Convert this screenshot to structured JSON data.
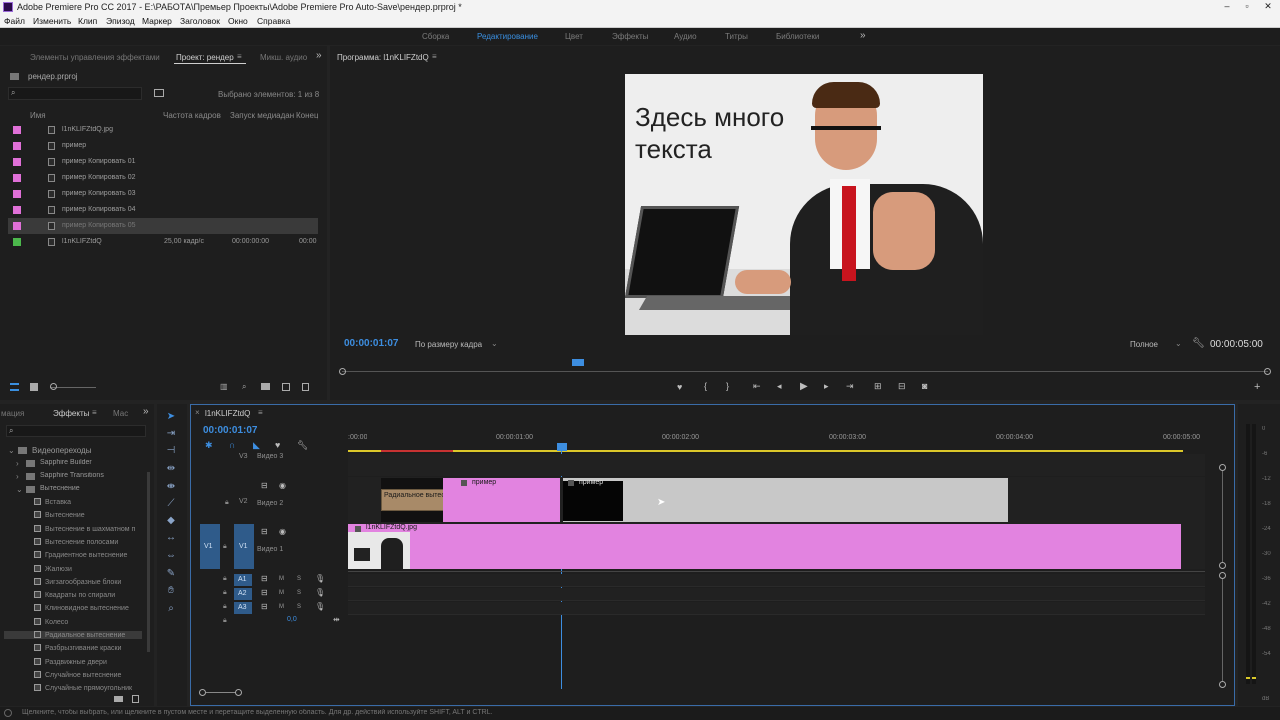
{
  "window": {
    "title": "Adobe Premiere Pro CC 2017 - E:\\РАБОТА\\Премьер Проекты\\Adobe Premiere Pro Auto-Save\\рендер.prproj *"
  },
  "menu": [
    "Файл",
    "Изменить",
    "Клип",
    "Эпизод",
    "Маркер",
    "Заголовок",
    "Окно",
    "Справка"
  ],
  "workspaces": [
    "Сборка",
    "Редактирование",
    "Цвет",
    "Эффекты",
    "Аудио",
    "Титры",
    "Библиотеки"
  ],
  "project": {
    "tabs": [
      "Элементы управления эффектами",
      "Проект: рендер",
      "Микш. аудио"
    ],
    "filename": "рендер.prproj",
    "selected": "Выбрано элементов: 1 из 8",
    "columns": [
      "Имя",
      "Частота кадров",
      "Запуск медиаданн",
      "Конец"
    ],
    "items": [
      {
        "name": "l1nKLIFZtdQ.jpg",
        "fps": "",
        "start": "",
        "color": "#e070d8"
      },
      {
        "name": "пример",
        "fps": "",
        "start": "",
        "color": "#e070d8"
      },
      {
        "name": "пример Копировать 01",
        "fps": "",
        "start": "",
        "color": "#e070d8"
      },
      {
        "name": "пример Копировать 02",
        "fps": "",
        "start": "",
        "color": "#e070d8"
      },
      {
        "name": "пример Копировать 03",
        "fps": "",
        "start": "",
        "color": "#e070d8"
      },
      {
        "name": "пример Копировать 04",
        "fps": "",
        "start": "",
        "color": "#e070d8"
      },
      {
        "name": "пример Копировать 05",
        "fps": "",
        "start": "",
        "color": "#e070d8"
      },
      {
        "name": "l1nKLIFZtdQ",
        "fps": "25,00 кадр/с",
        "start": "00:00:00:00",
        "end": "00:00",
        "color": "#4cb84c"
      }
    ]
  },
  "program": {
    "tab": "Программа: l1nKLIFZtdQ",
    "overlay_line1": "Здесь много",
    "overlay_line2": "текста",
    "timecode": "00:00:01:07",
    "fit": "По размеру кадра",
    "quality": "Полное",
    "duration": "00:00:05:00"
  },
  "effects": {
    "tabs": [
      "мация",
      "Эффекты",
      "Мас"
    ],
    "root": "Видеопереходы",
    "folders": [
      "Sapphire Builder",
      "Sapphire Transitions",
      "Вытеснение"
    ],
    "items": [
      "Вставка",
      "Вытеснение",
      "Вытеснение в шахматном п",
      "Вытеснение полосами",
      "Градиентное вытеснение",
      "Жалюзи",
      "Зигзагообразные блоки",
      "Квадраты по спирали",
      "Клиновидное вытеснение",
      "Колесо",
      "Радиальное вытеснение",
      "Разбрызгивание краски",
      "Раздвижные двери",
      "Случайное вытеснение",
      "Случайные прямоугольник"
    ]
  },
  "timeline": {
    "tab": "l1nKLIFZtdQ",
    "timecode": "00:00:01:07",
    "ruler": [
      ":00:00",
      "00:00:01:00",
      "00:00:02:00",
      "00:00:03:00",
      "00:00:04:00",
      "00:00:05:00"
    ],
    "tracks": {
      "v3": "V3",
      "v3_name": "Видео 3",
      "v2": "V2",
      "v2_name": "Видео 2",
      "v1": "V1",
      "v1_name": "Видео 1",
      "a1": "A1",
      "a2": "A2",
      "a3": "A3",
      "src": "V1",
      "m": "M",
      "s": "S",
      "vol": "0,0"
    },
    "clips": {
      "v2a": "пример",
      "v2b": "пример",
      "transition": "Радиальное вытесне",
      "v1": "l1nKLIFZtdQ.jpg"
    },
    "meter": [
      "0",
      "-6",
      "-12",
      "-18",
      "-24",
      "-30",
      "-36",
      "-42",
      "-48",
      "-54",
      "dB"
    ]
  },
  "status": "Щелкните, чтобы выбрать, или щелкните в пустом месте и перетащите выделенную область. Для др. действий используйте SHIFT, ALT и CTRL."
}
